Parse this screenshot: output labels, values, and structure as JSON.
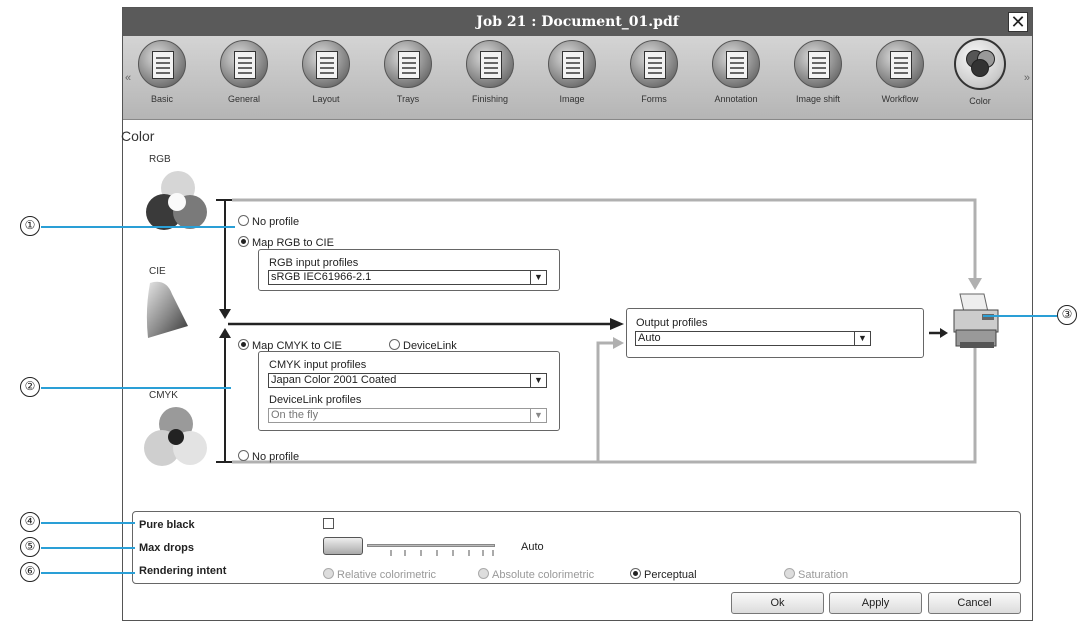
{
  "window": {
    "title": "Job 21 : Document_01.pdf",
    "close_glyph": "✕"
  },
  "toolbar": {
    "left_arrow": "«",
    "right_arrow": "»",
    "items": [
      {
        "label": "Basic",
        "icon": "document-icon"
      },
      {
        "label": "General",
        "icon": "general-icon"
      },
      {
        "label": "Layout",
        "icon": "layout-icon"
      },
      {
        "label": "Trays",
        "icon": "trays-icon"
      },
      {
        "label": "Finishing",
        "icon": "finishing-icon"
      },
      {
        "label": "Image",
        "icon": "image-icon"
      },
      {
        "label": "Forms",
        "icon": "forms-icon"
      },
      {
        "label": "Annotation",
        "icon": "annotation-icon"
      },
      {
        "label": "Image shift",
        "icon": "image-shift-icon"
      },
      {
        "label": "Workflow",
        "icon": "workflow-icon"
      },
      {
        "label": "Color",
        "icon": "color-icon",
        "active": true
      }
    ]
  },
  "color": {
    "title": "Color",
    "rgb_label": "RGB",
    "cie_label": "CIE",
    "cmyk_label": "CMYK",
    "rgb_options": {
      "no_profile": "No profile",
      "map": "Map RGB to CIE",
      "selected": "map"
    },
    "rgb_input": {
      "label": "RGB input profiles",
      "value": "sRGB IEC61966-2.1"
    },
    "cmyk_options": {
      "map": "Map CMYK to CIE",
      "devicelink": "DeviceLink",
      "no_profile": "No profile",
      "selected": "map"
    },
    "cmyk_input": {
      "label": "CMYK input profiles",
      "value": "Japan Color 2001 Coated"
    },
    "devicelink": {
      "label": "DeviceLink profiles",
      "value": "On the fly"
    },
    "output": {
      "label": "Output profiles",
      "value": "Auto"
    }
  },
  "settings": {
    "pure_black": {
      "label": "Pure black",
      "checked": false
    },
    "max_drops": {
      "label": "Max drops",
      "value": "Auto"
    },
    "rendering_intent": {
      "label": "Rendering intent",
      "options": [
        "Relative colorimetric",
        "Absolute colorimetric",
        "Perceptual",
        "Saturation"
      ],
      "selected": "Perceptual"
    }
  },
  "buttons": {
    "ok": "Ok",
    "apply": "Apply",
    "cancel": "Cancel"
  },
  "callouts": [
    "①",
    "②",
    "③",
    "④",
    "⑤",
    "⑥"
  ],
  "colors": {
    "callout_line": "#2a9fd6",
    "titlebar": "#5a5a5a",
    "flow_gray": "#b0b0b0"
  }
}
